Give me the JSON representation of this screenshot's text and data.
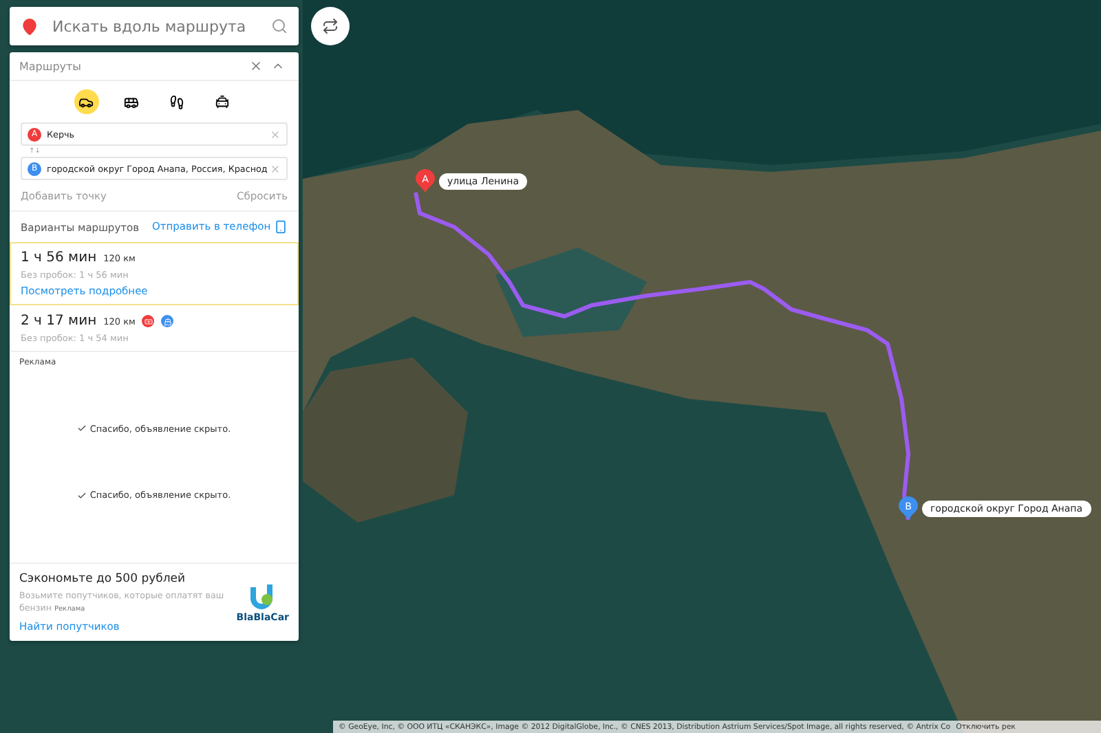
{
  "search": {
    "placeholder": "Искать вдоль маршрута"
  },
  "routes_panel": {
    "title": "Маршруты",
    "modes": [
      {
        "kind": "car",
        "selected": true
      },
      {
        "kind": "bus",
        "selected": false
      },
      {
        "kind": "walk",
        "selected": false
      },
      {
        "kind": "taxi",
        "selected": false
      }
    ],
    "points": [
      {
        "letter": "A",
        "value": "Керчь",
        "color": "#f03c3c"
      },
      {
        "letter": "B",
        "value": "городской округ Город Анапа, Россия, Краснод",
        "color": "#3d8ff0"
      }
    ],
    "swap": "↑↓",
    "add_point": "Добавить точку",
    "reset": "Сбросить",
    "variants_label": "Варианты маршрутов",
    "send_to_phone": "Отправить в телефон",
    "routes": [
      {
        "time": "1 ч 56 мин",
        "distance": "120 км",
        "no_traffic": "Без пробок: 1 ч 56 мин",
        "details": "Посмотреть подробнее",
        "selected": true
      },
      {
        "time": "2 ч 17 мин",
        "distance": "120 км",
        "no_traffic": "Без пробок: 1 ч 54 мин",
        "selected": false,
        "badges": [
          {
            "kind": "toll",
            "color": "#f03c3c"
          },
          {
            "kind": "ferry",
            "color": "#3d8ff0"
          }
        ]
      }
    ]
  },
  "ads": {
    "label": "Реклама",
    "hidden_notices": [
      "Спасибо, объявление скрыто.",
      "Спасибо, объявление скрыто."
    ],
    "promo": {
      "title": "Сэкономьте до 500 рублей",
      "text": "Возьмите попутчиков, которые оплатят ваш бензин",
      "tag": "Реклама",
      "link": "Найти попутчиков",
      "logo": "BlaBlaCar"
    }
  },
  "map": {
    "pins": [
      {
        "letter": "A",
        "label": "улица Ленина",
        "color": "#f03c3c"
      },
      {
        "letter": "B",
        "label": "городской округ Город Анапа",
        "color": "#3d8ff0"
      }
    ],
    "attribution": "© GeoEye, Inc, © ООО ИТЦ «СКАНЭКС», Image © 2012 DigitalGlobe, Inc., © CNES 2013, Distribution Astrium Services/Spot Image, all rights reserved, © Antrix Co",
    "attribution_link": "Отключить рек"
  }
}
